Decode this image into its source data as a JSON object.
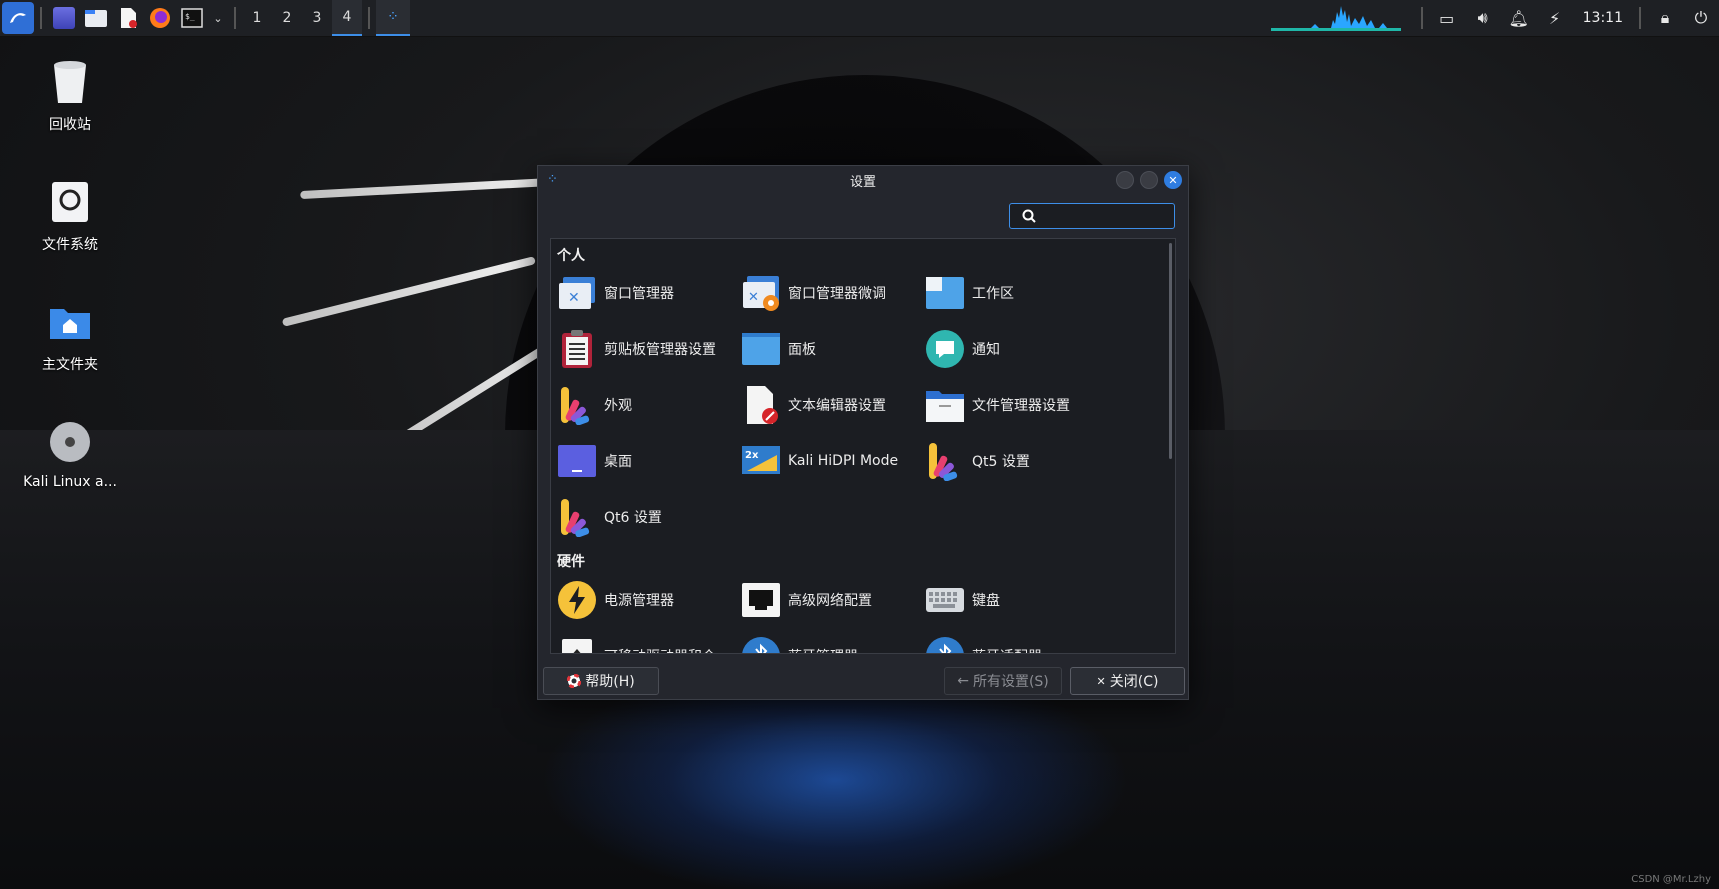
{
  "taskbar": {
    "workspaces": [
      "1",
      "2",
      "3",
      "4"
    ],
    "active_workspace": "4",
    "clock": "13:11"
  },
  "desktop": {
    "icons": [
      {
        "label": "回收站",
        "icon": "trash-icon"
      },
      {
        "label": "文件系统",
        "icon": "drive-icon"
      },
      {
        "label": "主文件夹",
        "icon": "home-folder-icon"
      },
      {
        "label": "Kali Linux a...",
        "icon": "disc-icon"
      }
    ]
  },
  "dialog": {
    "title": "设置",
    "search": {
      "value": "",
      "placeholder": ""
    },
    "sections": [
      {
        "title": "个人",
        "items": [
          {
            "label": "窗口管理器",
            "icon": "window-manager-icon"
          },
          {
            "label": "窗口管理器微调",
            "icon": "window-manager-tweaks-icon"
          },
          {
            "label": "工作区",
            "icon": "workspaces-icon"
          },
          {
            "label": "剪贴板管理器设置",
            "icon": "clipboard-icon"
          },
          {
            "label": "面板",
            "icon": "panel-icon"
          },
          {
            "label": "通知",
            "icon": "notification-icon"
          },
          {
            "label": "外观",
            "icon": "appearance-icon"
          },
          {
            "label": "文本编辑器设置",
            "icon": "text-editor-icon"
          },
          {
            "label": "文件管理器设置",
            "icon": "file-manager-icon"
          },
          {
            "label": "桌面",
            "icon": "desktop-icon"
          },
          {
            "label": "Kali HiDPI Mode",
            "icon": "hidpi-icon"
          },
          {
            "label": "Qt5 设置",
            "icon": "qt5-icon"
          },
          {
            "label": "Qt6 设置",
            "icon": "qt6-icon"
          }
        ]
      },
      {
        "title": "硬件",
        "items": [
          {
            "label": "电源管理器",
            "icon": "power-icon"
          },
          {
            "label": "高级网络配置",
            "icon": "network-icon"
          },
          {
            "label": "键盘",
            "icon": "keyboard-icon"
          },
          {
            "label": "可移动驱动器和介",
            "icon": "removable-drive-icon"
          },
          {
            "label": "蓝牙管理器",
            "icon": "bluetooth-icon"
          },
          {
            "label": "蓝牙适配器",
            "icon": "bluetooth-adapter-icon"
          }
        ]
      }
    ],
    "buttons": {
      "help": "帮助(H)",
      "all_settings": "所有设置(S)",
      "close": "关闭(C)"
    }
  },
  "watermark": "CSDN @Mr.Lzhy"
}
